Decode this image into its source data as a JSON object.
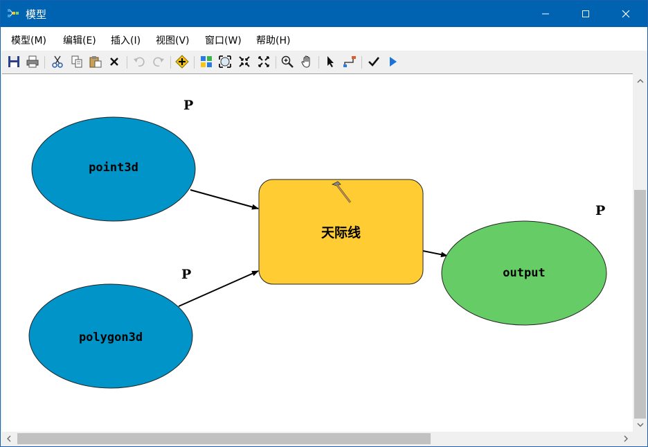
{
  "window": {
    "title": "模型"
  },
  "menu": [
    "模型(M)",
    "编辑(E)",
    "插入(I)",
    "视图(V)",
    "窗口(W)",
    "帮助(H)"
  ],
  "toolbar": {
    "icons": [
      "save-icon",
      "print-icon",
      "cut-icon",
      "copy-icon",
      "paste-icon",
      "delete-icon",
      "undo-icon",
      "redo-icon",
      "add-data-icon",
      "auto-layout-icon",
      "full-extent-icon",
      "fixed-zoom-in-icon",
      "fixed-zoom-out-icon",
      "zoom-in-icon",
      "pan-icon",
      "select-icon",
      "connect-icon",
      "validate-icon",
      "run-icon"
    ]
  },
  "diagram": {
    "inputs": [
      {
        "label": "point3d",
        "color": "#0094c8"
      },
      {
        "label": "polygon3d",
        "color": "#0094c8"
      }
    ],
    "tool": {
      "label": "天际线",
      "color": "#ffcc33"
    },
    "output": {
      "label": "output",
      "color": "#66cc66"
    },
    "param_markers": [
      "P",
      "P",
      "P"
    ]
  }
}
